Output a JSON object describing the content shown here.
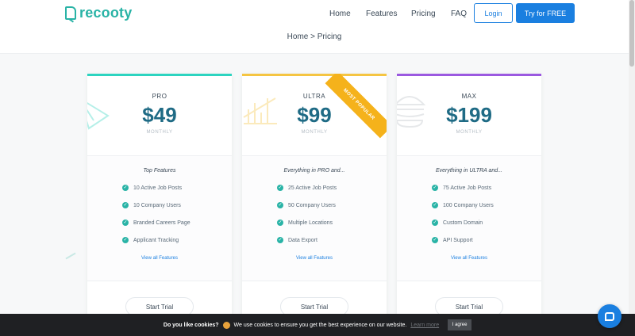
{
  "header": {
    "logo_text": "recooty",
    "nav": [
      "Home",
      "Features",
      "Pricing",
      "FAQ"
    ],
    "login_label": "Login",
    "try_label": "Try for FREE"
  },
  "breadcrumb": "Home  >  Pricing",
  "plans": [
    {
      "name": "PRO",
      "price": "$49",
      "period": "MONTHLY",
      "accent": "#2dd4c0",
      "features_title": "Top Features",
      "features": [
        "10 Active Job Posts",
        "10 Company Users",
        "Branded Careers Page",
        "Applicant Tracking"
      ],
      "view_all": "View all Features",
      "cta": "Start Trial"
    },
    {
      "name": "ULTRA",
      "price": "$99",
      "period": "MONTHLY",
      "accent": "#f5c542",
      "ribbon": "MOST POPULAR",
      "features_title": "Everything in PRO and...",
      "features": [
        "25 Active Job Posts",
        "50 Company Users",
        "Multiple Locations",
        "Data Export"
      ],
      "view_all": "View all Features",
      "cta": "Start Trial"
    },
    {
      "name": "MAX",
      "price": "$199",
      "period": "MONTHLY",
      "accent": "#9b59e0",
      "features_title": "Everything in ULTRA and...",
      "features": [
        "75 Active Job Posts",
        "100 Company Users",
        "Custom Domain",
        "API Support"
      ],
      "view_all": "View all Features",
      "cta": "Start Trial"
    }
  ],
  "cookie": {
    "question": "Do you like cookies?",
    "message": "We use cookies to ensure you get the best experience on our website.",
    "learn_more": "Learn more",
    "agree": "I agree"
  },
  "colors": {
    "brand": "#29b3a6",
    "primary": "#1a7fe0",
    "price": "#1f6b85",
    "ribbon": "#f5b21b"
  },
  "icons": {
    "logo": "document-search-icon",
    "check": "check-circle-icon",
    "chat": "chat-bubble-icon",
    "cookie": "cookie-icon"
  }
}
